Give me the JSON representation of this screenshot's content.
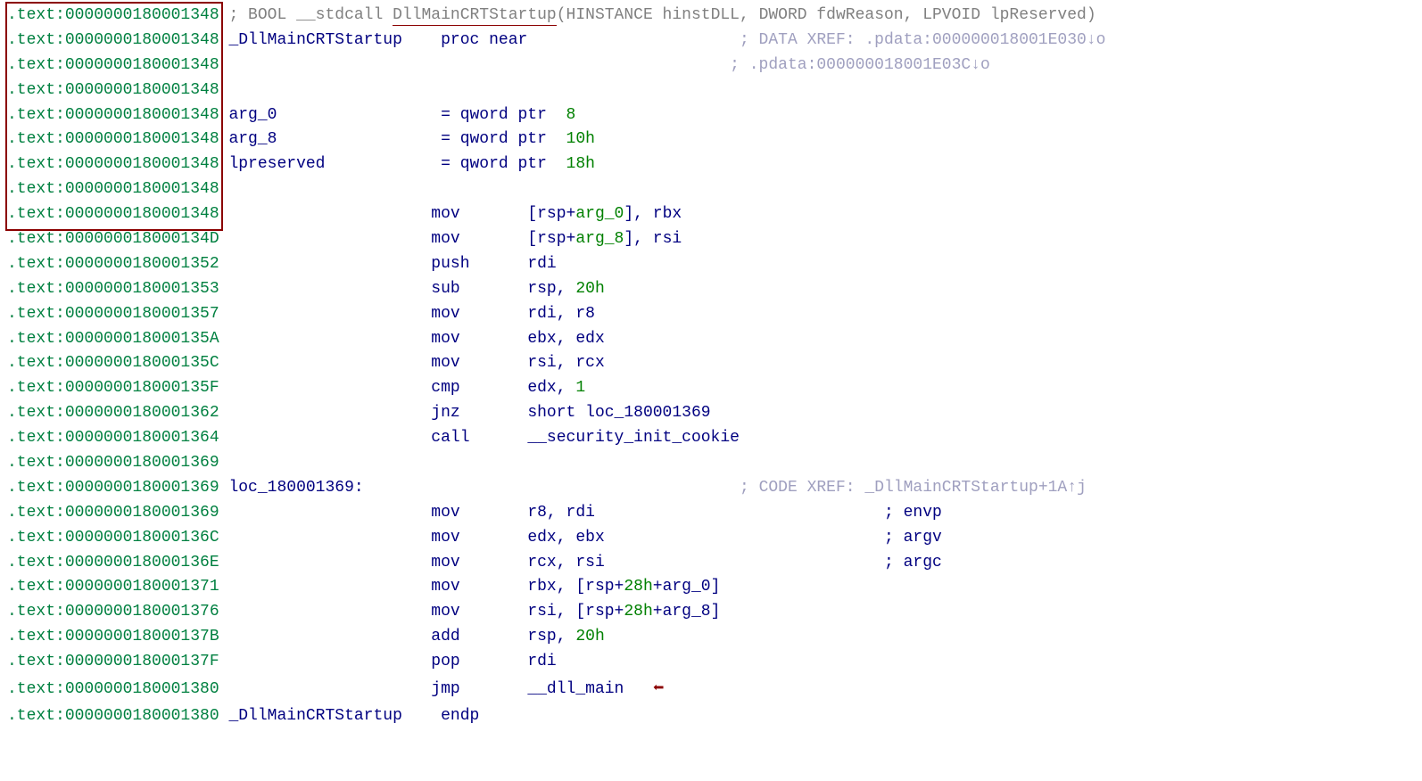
{
  "boxed_addr_count": 9,
  "signature": {
    "pre": "; BOOL  __stdcall",
    "name": "DllMainCRTStartup",
    "args": "(HINSTANCE hinstDLL, DWORD fdwReason, LPVOID lpReserved)"
  },
  "lines": [
    {
      "addr": "0000000180001348",
      "col1": {
        "t": "comment",
        "v": "__SIG__"
      }
    },
    {
      "addr": "0000000180001348",
      "col1": {
        "t": "ident",
        "v": "_DllMainCRTStartup"
      },
      "col2": {
        "t": "kw",
        "v": "proc near"
      },
      "col4xref": "; DATA XREF: .pdata:000000018001E030↓o"
    },
    {
      "addr": "0000000180001348",
      "col4xref": "; .pdata:000000018001E03C↓o"
    },
    {
      "addr": "0000000180001348"
    },
    {
      "addr": "0000000180001348",
      "col1": {
        "t": "ident",
        "v": "arg_0"
      },
      "col2": {
        "t": "plain",
        "v": "= qword ptr  8",
        "imm_tail": "8"
      }
    },
    {
      "addr": "0000000180001348",
      "col1": {
        "t": "ident",
        "v": "arg_8"
      },
      "col2": {
        "t": "plain",
        "v": "= qword ptr  10h",
        "imm_tail": "10h"
      }
    },
    {
      "addr": "0000000180001348",
      "col1": {
        "t": "ident",
        "v": "lpreserved"
      },
      "col2": {
        "t": "plain",
        "v": "= qword ptr  18h",
        "imm_tail": "18h"
      }
    },
    {
      "addr": "0000000180001348"
    },
    {
      "addr": "0000000180001348",
      "col2": {
        "t": "mn",
        "v": "mov"
      },
      "col3": {
        "v": "[rsp+arg_0], rbx",
        "imm": "arg_0"
      }
    },
    {
      "addr": "000000018000134D",
      "col2": {
        "t": "mn",
        "v": "mov"
      },
      "col3": {
        "v": "[rsp+arg_8], rsi",
        "imm": "arg_8"
      }
    },
    {
      "addr": "0000000180001352",
      "col2": {
        "t": "mn",
        "v": "push"
      },
      "col3": {
        "v": "rdi"
      }
    },
    {
      "addr": "0000000180001353",
      "col2": {
        "t": "mn",
        "v": "sub"
      },
      "col3": {
        "v": "rsp, 20h",
        "imm": "20h"
      }
    },
    {
      "addr": "0000000180001357",
      "col2": {
        "t": "mn",
        "v": "mov"
      },
      "col3": {
        "v": "rdi, r8"
      }
    },
    {
      "addr": "000000018000135A",
      "col2": {
        "t": "mn",
        "v": "mov"
      },
      "col3": {
        "v": "ebx, edx"
      }
    },
    {
      "addr": "000000018000135C",
      "col2": {
        "t": "mn",
        "v": "mov"
      },
      "col3": {
        "v": "rsi, rcx"
      }
    },
    {
      "addr": "000000018000135F",
      "col2": {
        "t": "mn",
        "v": "cmp"
      },
      "col3": {
        "v": "edx, 1",
        "imm": "1"
      }
    },
    {
      "addr": "0000000180001362",
      "col2": {
        "t": "mn",
        "v": "jnz"
      },
      "col3": {
        "v": "short loc_180001369",
        "link": "loc_180001369"
      }
    },
    {
      "addr": "0000000180001364",
      "col2": {
        "t": "mn",
        "v": "call"
      },
      "col3": {
        "v": "__security_init_cookie",
        "link": "__security_init_cookie"
      }
    },
    {
      "addr": "0000000180001369"
    },
    {
      "addr": "0000000180001369",
      "col1": {
        "t": "ident",
        "v": "loc_180001369:"
      },
      "col4xref": "; CODE XREF: _DllMainCRTStartup+1A↑j"
    },
    {
      "addr": "0000000180001369",
      "col2": {
        "t": "mn",
        "v": "mov"
      },
      "col3": {
        "v": "r8, rdi"
      },
      "col4cmt": "; envp"
    },
    {
      "addr": "000000018000136C",
      "col2": {
        "t": "mn",
        "v": "mov"
      },
      "col3": {
        "v": "edx, ebx"
      },
      "col4cmt": "; argv"
    },
    {
      "addr": "000000018000136E",
      "col2": {
        "t": "mn",
        "v": "mov"
      },
      "col3": {
        "v": "rcx, rsi"
      },
      "col4cmt": "; argc"
    },
    {
      "addr": "0000000180001371",
      "col2": {
        "t": "mn",
        "v": "mov"
      },
      "col3": {
        "v": "rbx, [rsp+28h+arg_0]",
        "imm": "28h"
      }
    },
    {
      "addr": "0000000180001376",
      "col2": {
        "t": "mn",
        "v": "mov"
      },
      "col3": {
        "v": "rsi, [rsp+28h+arg_8]",
        "imm": "28h"
      }
    },
    {
      "addr": "000000018000137B",
      "col2": {
        "t": "mn",
        "v": "add"
      },
      "col3": {
        "v": "rsp, 20h",
        "imm": "20h"
      }
    },
    {
      "addr": "000000018000137F",
      "col2": {
        "t": "mn",
        "v": "pop"
      },
      "col3": {
        "v": "rdi"
      }
    },
    {
      "addr": "0000000180001380",
      "col2": {
        "t": "mn",
        "v": "jmp"
      },
      "col3": {
        "v": "__dll_main",
        "link": "__dll_main"
      },
      "arrow": true
    },
    {
      "addr": "0000000180001380",
      "col1": {
        "t": "ident",
        "v": "_DllMainCRTStartup"
      },
      "col2": {
        "t": "kw",
        "v": "endp"
      }
    }
  ]
}
